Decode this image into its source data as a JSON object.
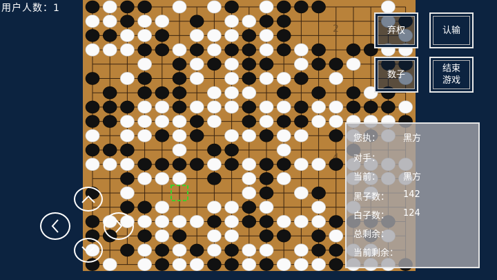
{
  "status": {
    "online_users": "用户人数：1"
  },
  "board": {
    "size": 19,
    "wood_color": "#b9823a",
    "line_color": "#3a2410",
    "coord_labels": [
      "2",
      "3",
      "4"
    ],
    "marker": "last-move",
    "rows": [
      "BWBB.W.WB.WBBB...W.",
      "WWBWW.B.WWBB.....WB",
      "BBWWB.WWWBWB......W",
      "WWWBBWBWBBWBWB.BBWW",
      "...W.BWBWBB.WBBW.BB",
      "B.WB.BW.WBWWB.W...W",
      ".B.BBB.WWW.B.B.BWB.",
      "BBBWWBWWWBWWBWWBBBW",
      "BBWWWWBW.BWBBWWWWWB",
      "W.WWBWB.WWBWW.BWBW.",
      "BBB..W.BB..W...B...",
      "WWWBBBBWBWBBWWBWWWW",
      "..BWWW.B.WBW...WWWW",
      "B.W......WB.WB..W..",
      "..BBW..WWBW..W.W...",
      "BWWWWWWBWBBWWWBBBB.",
      "BB.BWB.WW.BB.BW.BW.",
      "W.BWBWBWBWW.WBBWW..",
      "BW.WBWWBBWBWWWBWWWB"
    ]
  },
  "buttons": {
    "give_up": "弃权",
    "resign": "认输",
    "count": "数子",
    "end_game": "结束\n游戏"
  },
  "info": {
    "you_hold_label": "您执：",
    "you_hold_value": "黑方",
    "opponent_label": "对手：",
    "opponent_value": "",
    "current_label": "当前：",
    "current_value": "黑方",
    "black_count_label": "黑子数：",
    "black_count_value": "142",
    "white_count_label": "白子数：",
    "white_count_value": "124",
    "total_remaining_label": "总剩余：",
    "total_remaining_value": "",
    "current_remaining_label": "当前剩余：",
    "current_remaining_value": ""
  },
  "nav": {
    "up": "up-icon",
    "left": "left-icon",
    "right": "right-icon",
    "down": "down-icon"
  }
}
